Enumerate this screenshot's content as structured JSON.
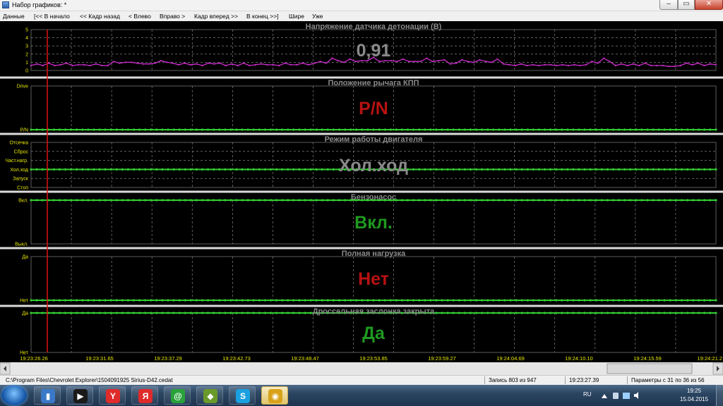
{
  "window": {
    "title": "Набор графиков: *",
    "min_label": "–",
    "max_label": "▭",
    "close_label": "✕"
  },
  "menu": [
    "Данные",
    "[<< В начало",
    "<< Кадр назад",
    "< Влево",
    "Вправо >",
    "Кадр вперед >>",
    "В конец >>]",
    "Шире",
    "Уже"
  ],
  "colors": {
    "background": "#000000",
    "grid": "#9a9a9a",
    "trace": "#cc2ccc",
    "state_line": "#33cc33",
    "cursor": "#e01010",
    "axis_text": "#e8e800",
    "time_text": "#e8e800",
    "title": "#8a8a8a"
  },
  "panels": [
    {
      "title": "Напряжение датчика детонации  (В)",
      "value": "0,91",
      "value_color": "#8a8a8a",
      "yticks": [
        "5",
        "4",
        "3",
        "2",
        "1",
        "0"
      ]
    },
    {
      "title": "Положение рычага КПП",
      "value": "P/N",
      "value_color": "#b81212",
      "yticks": [
        "Drive",
        "P/N"
      ]
    },
    {
      "title": "Режим работы двигателя",
      "value": "Хол.ход",
      "value_color": "#8a8a8a",
      "yticks": [
        "Отсечка",
        "Сброс",
        "Част.нагр.",
        "Хол.ход",
        "Запуск",
        "Стоп"
      ]
    },
    {
      "title": "Бензонасос",
      "value": "Вкл.",
      "value_color": "#1f9a1f",
      "yticks": [
        "Вкл.",
        "Выкл."
      ]
    },
    {
      "title": "Полная нагрузка",
      "value": "Нет",
      "value_color": "#b81212",
      "yticks": [
        "Да",
        "Нет"
      ]
    },
    {
      "title": "Дроссельная заслонка закрыта",
      "value": "Да",
      "value_color": "#1f9a1f",
      "yticks": [
        "Да",
        "Нет"
      ]
    }
  ],
  "time_labels": [
    "19:23:26.26",
    "19:23:31.65",
    "19:23:37.29",
    "19:23:42.73",
    "19:23:48.47",
    "19:23:53.85",
    "19:23:59.27",
    "19:24:04.69",
    "19:24:10.10",
    "19:24:15.59",
    "19:24:21.2"
  ],
  "chart_data": [
    {
      "type": "line",
      "title": "Напряжение датчика детонации  (В)",
      "ylim": [
        0,
        5
      ],
      "x": [
        "19:23:26.26",
        "19:23:31.65",
        "19:23:37.29",
        "19:23:42.73",
        "19:23:48.47",
        "19:23:53.85",
        "19:23:59.27",
        "19:24:04.69",
        "19:24:10.10",
        "19:24:15.59",
        "19:24:21.2"
      ],
      "series": [
        {
          "values": [
            0.6,
            0.8,
            0.6,
            0.9,
            0.6,
            0.7,
            0.9,
            0.6,
            0.7,
            0.7,
            0.6,
            0.8,
            0.6,
            0.6,
            1.1,
            0.9,
            1.0,
            1.0,
            0.9,
            0.8,
            0.8,
            0.9,
            1.2,
            1.0,
            0.9,
            0.7,
            0.9,
            0.7,
            0.8,
            0.6,
            0.9,
            0.8,
            0.9,
            0.6,
            0.8,
            0.6,
            0.9,
            0.6,
            0.7,
            0.8,
            0.7,
            0.7,
            0.6,
            0.9,
            0.7,
            0.7,
            0.9,
            0.7,
            0.9,
            1.1,
            0.9,
            1.5,
            1.2,
            1.0,
            1.4,
            1.1,
            1.2,
            1.2,
            1.6,
            1.1,
            1.2,
            1.2,
            1.1,
            1.4,
            1.1,
            1.1,
            1.1,
            1.5,
            1.1,
            1.2,
            1.3,
            0.8,
            0.9,
            1.3,
            1.1,
            1.0,
            1.3,
            1.1,
            1.0,
            1.4,
            0.8,
            0.7,
            0.6,
            0.8,
            0.6,
            0.7,
            0.6,
            0.7,
            0.7,
            0.6,
            0.7,
            0.6,
            0.7,
            0.6,
            0.7,
            1.1,
            0.9,
            1.5,
            1.1,
            0.6,
            0.8,
            0.6,
            0.8,
            0.6,
            0.9,
            0.6,
            0.6,
            0.6,
            0.5,
            0.5,
            0.6,
            0.9,
            0.7,
            0.9,
            0.6,
            0.8,
            0.7
          ]
        }
      ]
    },
    {
      "type": "line",
      "title": "Положение рычага КПП",
      "categories": [
        "P/N",
        "Drive"
      ],
      "series": [
        {
          "values": [
            "P/N"
          ]
        }
      ]
    },
    {
      "type": "line",
      "title": "Режим работы двигателя",
      "categories": [
        "Стоп",
        "Запуск",
        "Хол.ход",
        "Част.нагр.",
        "Сброс",
        "Отсечка"
      ],
      "series": [
        {
          "values": [
            "Хол.ход"
          ]
        }
      ]
    },
    {
      "type": "line",
      "title": "Бензонасос",
      "categories": [
        "Выкл.",
        "Вкл."
      ],
      "series": [
        {
          "values": [
            "Вкл."
          ]
        }
      ]
    },
    {
      "type": "line",
      "title": "Полная нагрузка",
      "categories": [
        "Нет",
        "Да"
      ],
      "series": [
        {
          "values": [
            "Нет"
          ]
        }
      ]
    },
    {
      "type": "line",
      "title": "Дроссельная заслонка закрыта",
      "categories": [
        "Нет",
        "Да"
      ],
      "series": [
        {
          "values": [
            "Да"
          ]
        }
      ]
    }
  ],
  "status": {
    "path": "C:\\Program Files\\Chevrolet Explorer\\1504091925 Sirius-D42.cedat",
    "record": "Запись 803 из 947",
    "time": "19:23:27.39",
    "params": "Параметры с 31 по 36 из 56"
  },
  "taskbar": {
    "apps": [
      {
        "name": "explorer-files",
        "glyph": "▮",
        "color": "#3a79c8"
      },
      {
        "name": "media-player",
        "glyph": "▶",
        "color": "#1a1a1a"
      },
      {
        "name": "yandex-browser",
        "glyph": "Y",
        "color": "#e02b2b"
      },
      {
        "name": "yandex-search",
        "glyph": "Я",
        "color": "#e02b2b"
      },
      {
        "name": "at-messenger",
        "glyph": "@",
        "color": "#2aa23a"
      },
      {
        "name": "utility-app",
        "glyph": "◆",
        "color": "#6a9a2a"
      },
      {
        "name": "skype",
        "glyph": "S",
        "color": "#1aa0e0"
      },
      {
        "name": "chevrolet-explorer",
        "glyph": "◉",
        "color": "#d8a21a"
      }
    ],
    "lang": "RU",
    "time": "19:25",
    "date": "15.04.2015"
  }
}
